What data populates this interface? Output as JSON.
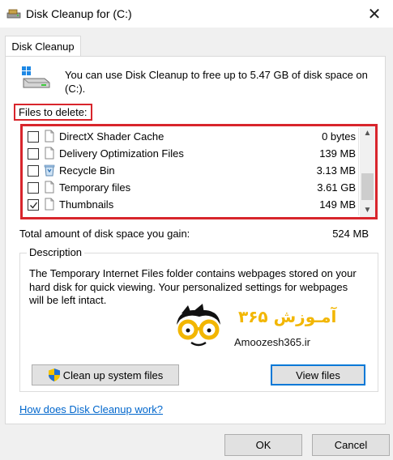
{
  "window": {
    "title": "Disk Cleanup for  (C:)",
    "close_glyph": "✕"
  },
  "tab": {
    "label": "Disk Cleanup"
  },
  "intro_text": "You can use Disk Cleanup to free up to 5.47 GB of disk space on (C:).",
  "files_to_delete_label": "Files to delete:",
  "files": [
    {
      "name": "DirectX Shader Cache",
      "size": "0 bytes",
      "checked": false,
      "icon": "file-icon"
    },
    {
      "name": "Delivery Optimization Files",
      "size": "139 MB",
      "checked": false,
      "icon": "file-icon"
    },
    {
      "name": "Recycle Bin",
      "size": "3.13 MB",
      "checked": false,
      "icon": "recycle-bin-icon"
    },
    {
      "name": "Temporary files",
      "size": "3.61 GB",
      "checked": false,
      "icon": "file-icon"
    },
    {
      "name": "Thumbnails",
      "size": "149 MB",
      "checked": true,
      "icon": "file-icon"
    }
  ],
  "total": {
    "label": "Total amount of disk space you gain:",
    "value": "524 MB"
  },
  "description": {
    "legend": "Description",
    "text": "The Temporary Internet Files folder contains webpages stored on your hard disk for quick viewing. Your personalized settings for webpages will be left intact."
  },
  "watermark": {
    "brand_text": "آمـوزش ۳۶۵",
    "site": "Amoozesh365.ir"
  },
  "buttons": {
    "cleanup_system": "Clean up system files",
    "view_files": "View files",
    "ok": "OK",
    "cancel": "Cancel"
  },
  "help_link": "How does Disk Cleanup work?",
  "colors": {
    "highlight_red": "#d8252c",
    "link_blue": "#0066cc",
    "focus_blue": "#0078d7"
  }
}
